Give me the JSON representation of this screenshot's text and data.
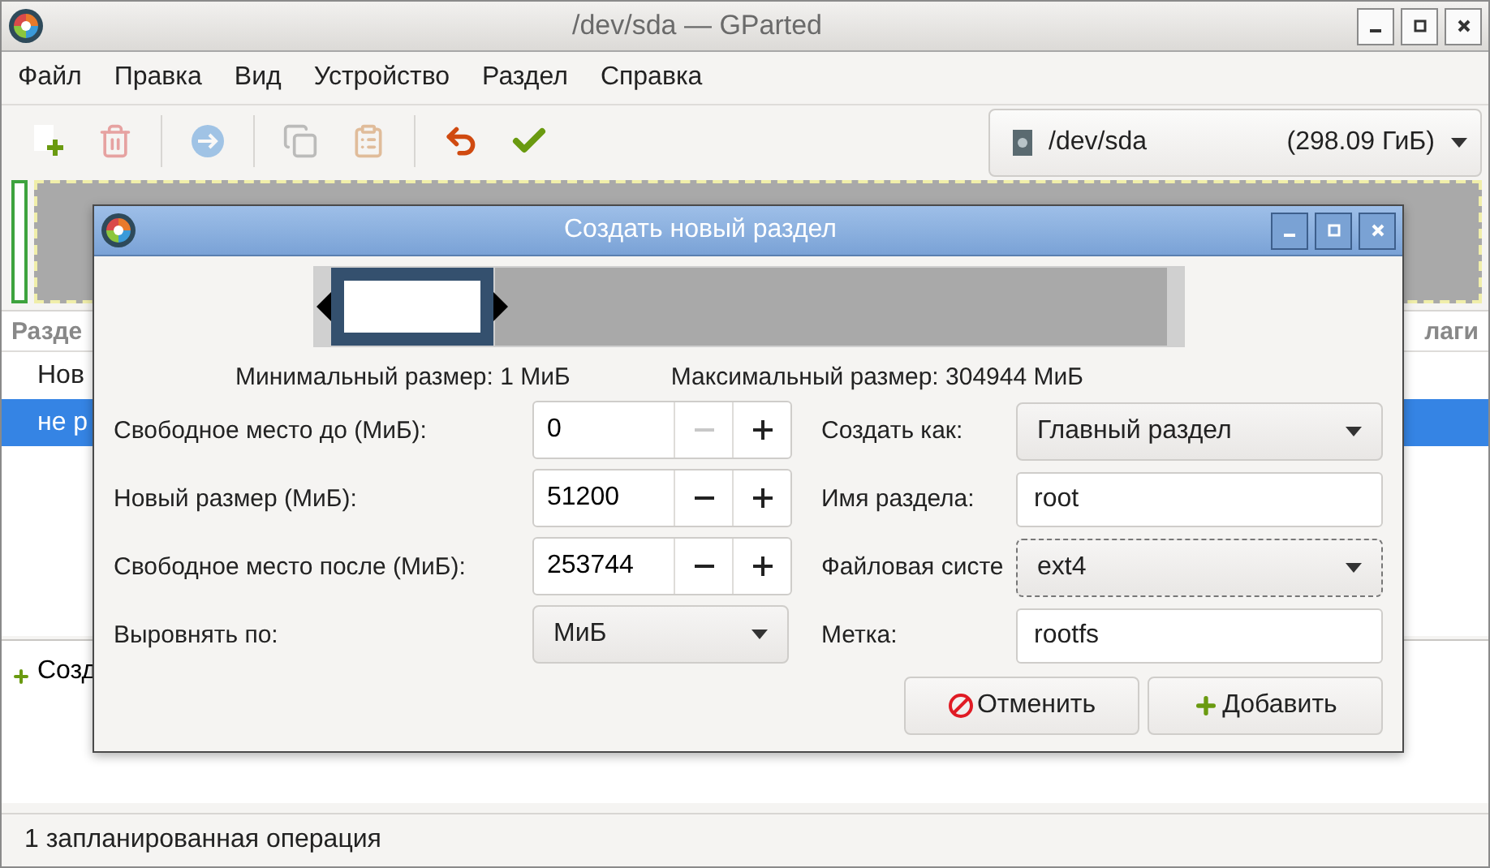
{
  "window": {
    "title": "/dev/sda — GParted"
  },
  "menu": [
    "Файл",
    "Правка",
    "Вид",
    "Устройство",
    "Раздел",
    "Справка"
  ],
  "toolbar": [
    {
      "kind": "new",
      "disabled": false
    },
    {
      "kind": "delete",
      "disabled": true
    },
    {
      "kind": "resize",
      "disabled": true
    },
    {
      "kind": "copy",
      "disabled": true
    },
    {
      "kind": "paste",
      "disabled": true
    },
    {
      "kind": "undo",
      "disabled": false
    },
    {
      "kind": "apply",
      "disabled": false
    }
  ],
  "device_selector": {
    "device": "/dev/sda",
    "size": "(298.09 ГиБ)"
  },
  "partition_table": {
    "columns": [
      "Разде",
      "лаги"
    ],
    "rows": [
      {
        "cell": "Нов",
        "selected": false
      },
      {
        "cell": "не р",
        "selected": true
      }
    ]
  },
  "operations": [
    "Созд"
  ],
  "status_bar": "1 запланированная операция",
  "dialog": {
    "title": "Создать новый раздел",
    "min_size": "Минимальный размер: 1 МиБ",
    "max_size": "Максимальный размер: 304944 МиБ",
    "spin_fields": [
      {
        "label": "Свободное место до (МиБ):",
        "value": "0",
        "minus_disabled": true
      },
      {
        "label": "Новый размер (МиБ):",
        "value": "51200",
        "minus_disabled": false
      },
      {
        "label": "Свободное место после (МиБ):",
        "value": "253744",
        "minus_disabled": false
      }
    ],
    "align": {
      "label": "Выровнять по:",
      "value": "МиБ"
    },
    "right_fields": [
      {
        "kind": "dropdown",
        "label": "Создать как:",
        "value": "Главный раздел",
        "focused": false
      },
      {
        "kind": "text",
        "label": "Имя раздела:",
        "value": "root",
        "focused": false
      },
      {
        "kind": "dropdown",
        "label": "Файловая систе",
        "value": "ext4",
        "focused": true
      },
      {
        "kind": "text",
        "label": "Метка:",
        "value": "rootfs",
        "focused": false
      }
    ],
    "buttons": [
      {
        "kind": "cancel",
        "label": "Отменить"
      },
      {
        "kind": "add",
        "label": "Добавить"
      }
    ]
  }
}
